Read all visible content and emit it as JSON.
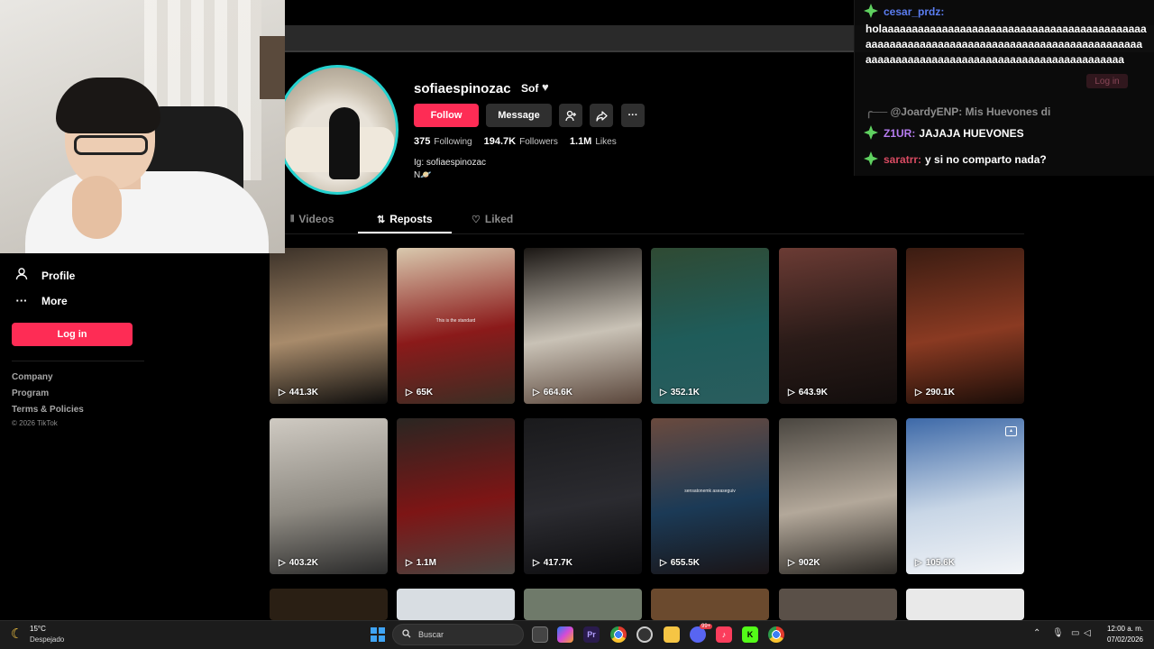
{
  "sidebar": {
    "items": [
      {
        "label": "Profile",
        "icon": "person-icon"
      },
      {
        "label": "More",
        "icon": "ellipsis-icon"
      }
    ],
    "login_label": "Log in",
    "footer_links": [
      "Company",
      "Program",
      "Terms & Policies"
    ],
    "copyright": "© 2026 TikTok"
  },
  "profile": {
    "username": "sofiaespinozac",
    "nickname": "Sof",
    "follow_label": "Follow",
    "message_label": "Message",
    "stats": [
      {
        "value": "375",
        "label": "Following"
      },
      {
        "value": "194.7K",
        "label": "Followers"
      },
      {
        "value": "1.1M",
        "label": "Likes"
      }
    ],
    "bio_line1": "Ig: sofiaespinozac",
    "bio_line2": "N🪐",
    "accent_color": "#fe2c55",
    "ring_color": "#25d2cf"
  },
  "tabs": [
    {
      "label": "Videos",
      "active": false
    },
    {
      "label": "Reposts",
      "active": true
    },
    {
      "label": "Liked",
      "active": false
    }
  ],
  "videos": [
    {
      "views": "441.3K",
      "caption": "",
      "colors": [
        "#3b3128",
        "#a88b6b",
        "#0e0d0c"
      ]
    },
    {
      "views": "65K",
      "caption": "This is the standard",
      "colors": [
        "#d9c9ae",
        "#8b1a1a",
        "#3a2e24"
      ]
    },
    {
      "views": "664.6K",
      "caption": "",
      "colors": [
        "#1b1714",
        "#c9c2b6",
        "#5a463b"
      ]
    },
    {
      "views": "352.1K",
      "caption": "",
      "colors": [
        "#2f4a33",
        "#1f5c5a",
        "#2a5d5e"
      ]
    },
    {
      "views": "643.9K",
      "caption": "",
      "colors": [
        "#6b3b34",
        "#2a1b18",
        "#120d0c"
      ]
    },
    {
      "views": "290.1K",
      "caption": "",
      "colors": [
        "#3a1c12",
        "#8a3a22",
        "#1a0d08"
      ]
    },
    {
      "views": "403.2K",
      "caption": "",
      "colors": [
        "#cfcac2",
        "#8e8a82",
        "#2a2a2a"
      ]
    },
    {
      "views": "1.1M",
      "caption": "",
      "colors": [
        "#2a2622",
        "#7d1515",
        "#4a4440"
      ]
    },
    {
      "views": "417.7K",
      "caption": "",
      "colors": [
        "#1a1a1c",
        "#2b2b30",
        "#0c0c0e"
      ]
    },
    {
      "views": "655.5K",
      "caption": "sensatonemk aseaseguiv",
      "colors": [
        "#6a4a3e",
        "#1b3a56",
        "#1a1416"
      ]
    },
    {
      "views": "902K",
      "caption": "",
      "colors": [
        "#4a4640",
        "#b3a89a",
        "#2c2925"
      ]
    },
    {
      "views": "105.6K",
      "caption": "",
      "colors": [
        "#3d69a8",
        "#c8d6e6",
        "#f2f4f7"
      ]
    }
  ],
  "chat": {
    "messages": [
      {
        "user": "cesar_prdz:",
        "user_color": "#5b7df0",
        "text": ""
      },
      {
        "user": "Z1UR:",
        "user_color": "#b67cf0",
        "text": "JAJAJA HUEVONES"
      },
      {
        "user": "saratrr:",
        "user_color": "#d94b62",
        "text": "y si no comparto nada?"
      }
    ],
    "long_message": "holaaaaaaaaaaaaaaaaaaaaaaaaaaaaaaaaaaaaaaaaaaaaaaaaaaaaaaaaaaaaaaaaaaaaaaaaaaaaaaaaaaaaaaaaaaaaaaaaaaaaaaaaaaaaaaaaaaaaaaaaaaaaaaaaaaaaa",
    "faded_message": "@JoardyENP: Mis Huevones di",
    "overlay_login_label": "Log in"
  },
  "taskbar": {
    "weather_temp": "15°C",
    "weather_desc": "Despejado",
    "search_placeholder": "Buscar",
    "time": "12:00 a. m.",
    "date": "07/02/2026",
    "discord_badge": "99+"
  }
}
